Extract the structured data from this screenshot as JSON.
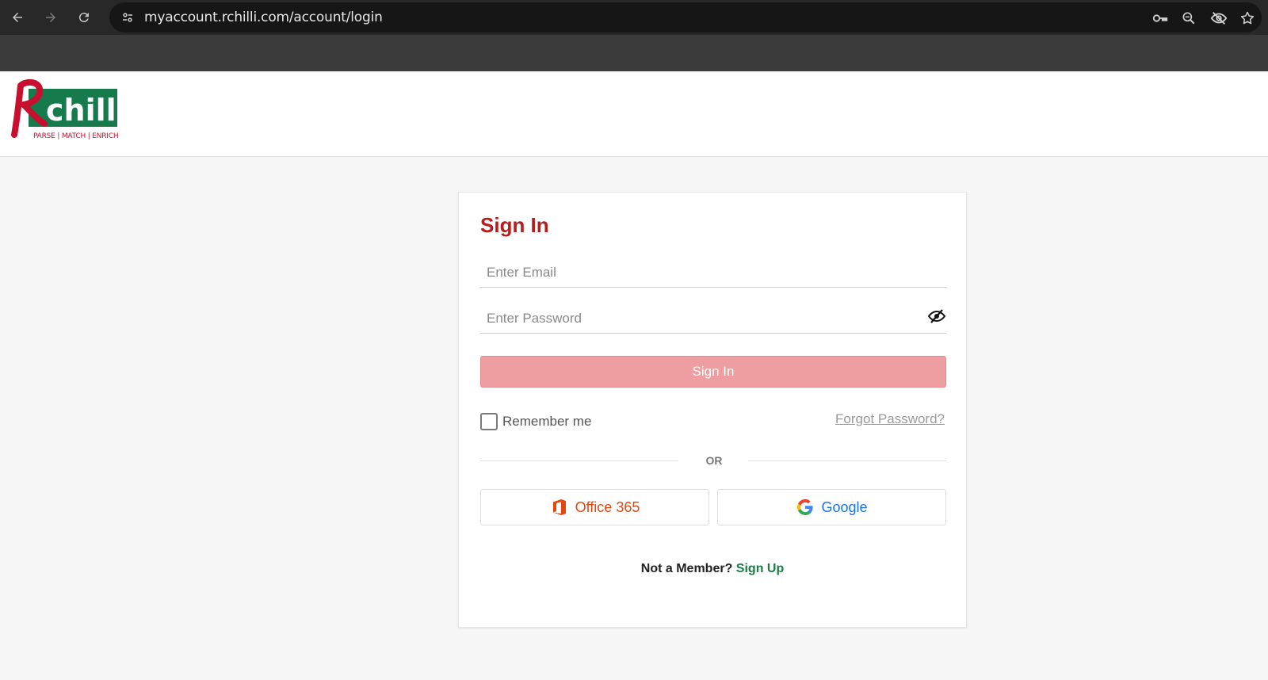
{
  "browser": {
    "url": "myaccount.rchilli.com/account/login"
  },
  "brand": {
    "name": "chilli",
    "tagline": "PARSE | MATCH | ENRICH",
    "colors": {
      "red": "#c8102e",
      "green": "#177a4d"
    }
  },
  "login": {
    "title": "Sign In",
    "email_placeholder": "Enter Email",
    "password_placeholder": "Enter Password",
    "submit_label": "Sign In",
    "remember_label": "Remember me",
    "forgot_label": "Forgot Password?",
    "divider_label": "OR",
    "office_label": "Office 365",
    "google_label": "Google",
    "member_prompt": "Not a Member?",
    "signup_label": "Sign Up"
  },
  "icons": {
    "back": "arrow-left-icon",
    "forward": "arrow-right-icon",
    "reload": "reload-icon",
    "site_info": "tune-icon",
    "password_key": "key-icon",
    "zoom": "zoom-icon",
    "tracking": "eye-off-icon",
    "bookmark": "star-icon",
    "password_toggle": "eye-slash-icon",
    "office": "office-icon",
    "google": "google-icon"
  }
}
